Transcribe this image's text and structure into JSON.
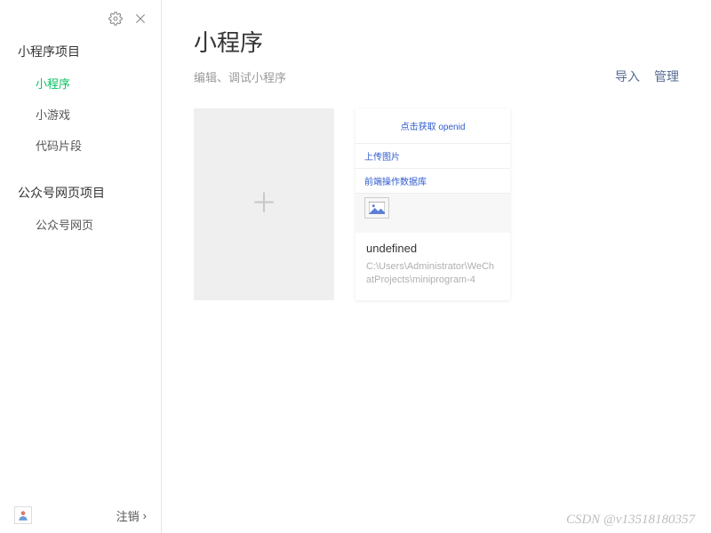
{
  "sidebar": {
    "sections": [
      {
        "title": "小程序项目",
        "items": [
          {
            "label": "小程序",
            "active": true
          },
          {
            "label": "小游戏",
            "active": false
          },
          {
            "label": "代码片段",
            "active": false
          }
        ]
      },
      {
        "title": "公众号网页项目",
        "items": [
          {
            "label": "公众号网页",
            "active": false
          }
        ]
      }
    ],
    "logout": "注销"
  },
  "content": {
    "title": "小程序",
    "subtitle": "编辑、调试小程序",
    "actions": {
      "import": "导入",
      "manage": "管理"
    }
  },
  "preview": {
    "get_openid": "点击获取 openid",
    "upload_image": "上传图片",
    "frontend_db": "前端操作数据库"
  },
  "project": {
    "name": "undefined",
    "path": "C:\\Users\\Administrator\\WeChatProjects\\miniprogram-4"
  },
  "watermark": "CSDN @v13518180357"
}
